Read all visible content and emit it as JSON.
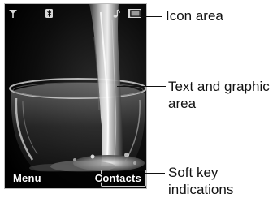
{
  "screen": {
    "softkeys": {
      "left": "Menu",
      "right": "Contacts"
    },
    "status_icons": [
      "signal-strength-icon",
      "bluetooth-icon",
      "ringtone-note-icon",
      "battery-icon"
    ],
    "wallpaper": "water-glass-splash-image"
  },
  "callouts": {
    "icon_area": "Icon area",
    "text_graphic_area": "Text and graphic\narea",
    "soft_key_indications": "Soft key\nindications"
  }
}
